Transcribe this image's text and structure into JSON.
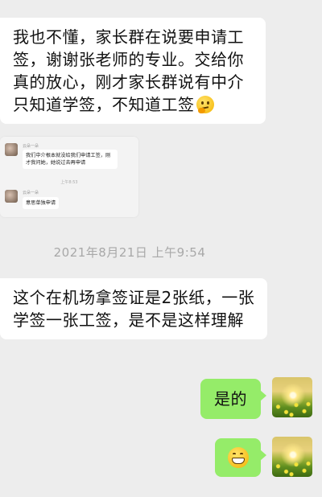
{
  "messages": {
    "msg1": "我也不懂，家长群在说要申请工签，谢谢张老师的专业。交给你真的放心，刚才家长群说有中介只知道学签，不知道工签",
    "msg1_emoji": "thinking-face-icon",
    "msg2": "这个在机场拿签证是2张纸，一张学签一张工签，是不是这样理解",
    "msg3": "是的",
    "msg4_emoji": "grinning-face-icon"
  },
  "embedded_screenshot": {
    "sender1": "云朵一朵",
    "bubble1": "我们中介根本就没给我们申请工签，刚才我问她，她说过去再申请",
    "time": "上午8:53",
    "sender2": "云朵一朵",
    "bubble2": "意思单独申请"
  },
  "timestamp": "2021年8月21日 上午9:54",
  "colors": {
    "background": "#ededed",
    "incoming_bubble": "#ffffff",
    "outgoing_bubble": "#95ec69",
    "timestamp_text": "#a8a8a8"
  }
}
